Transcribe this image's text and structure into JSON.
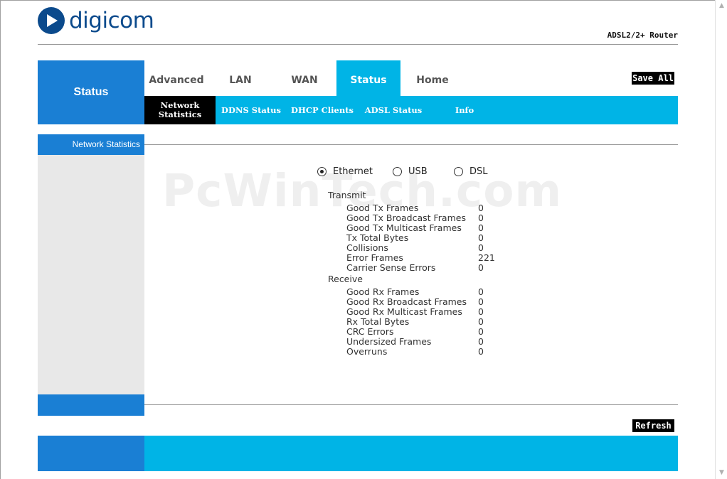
{
  "brand": {
    "logo_text": "digicom",
    "product": "ADSL2/2+ Router"
  },
  "colors": {
    "primary_blue": "#1a7fd4",
    "accent_cyan": "#00b4e6",
    "sidebar_gray": "#e8e8e8",
    "logo_navy": "#0b4a8c"
  },
  "nav": {
    "section_title": "Status",
    "tabs": [
      "Advanced",
      "LAN",
      "WAN",
      "Status",
      "Home"
    ],
    "active_tab": "Status",
    "save_label": "Save All",
    "subtabs": [
      "Network Statistics",
      "DDNS Status",
      "DHCP Clients",
      "ADSL Status",
      "Info"
    ],
    "active_subtab": "Network Statistics"
  },
  "sidebar": {
    "heading": "Network Statistics"
  },
  "watermark": "PcWinTech.com",
  "interface_options": [
    {
      "label": "Ethernet",
      "selected": true
    },
    {
      "label": "USB",
      "selected": false
    },
    {
      "label": "DSL",
      "selected": false
    }
  ],
  "transmit": {
    "label": "Transmit",
    "rows": [
      {
        "name": "Good Tx Frames",
        "value": "0"
      },
      {
        "name": "Good Tx Broadcast Frames",
        "value": "0"
      },
      {
        "name": "Good Tx Multicast Frames",
        "value": "0"
      },
      {
        "name": "Tx Total Bytes",
        "value": "0"
      },
      {
        "name": "Collisions",
        "value": "0"
      },
      {
        "name": "Error Frames",
        "value": "221"
      },
      {
        "name": "Carrier Sense Errors",
        "value": "0"
      }
    ]
  },
  "receive": {
    "label": "Receive",
    "rows": [
      {
        "name": "Good Rx Frames",
        "value": "0"
      },
      {
        "name": "Good Rx Broadcast Frames",
        "value": "0"
      },
      {
        "name": "Good Rx Multicast Frames",
        "value": "0"
      },
      {
        "name": "Rx Total Bytes",
        "value": "0"
      },
      {
        "name": "CRC Errors",
        "value": "0"
      },
      {
        "name": "Undersized Frames",
        "value": "0"
      },
      {
        "name": "Overruns",
        "value": "0"
      }
    ]
  },
  "refresh_label": "Refresh"
}
